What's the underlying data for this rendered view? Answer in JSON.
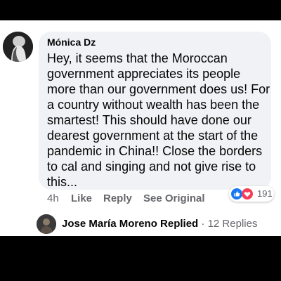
{
  "comment": {
    "author": "Mónica Dz",
    "text": "Hey, it seems that the Moroccan government appreciates its people more than our government does us! For a country without wealth has been the smartest! This should have done our dearest government at the start of the pandemic in China!! Close the borders to cal and singing and not give rise to this...",
    "time": "4h",
    "actions": {
      "like": "Like",
      "reply": "Reply",
      "see_original": "See Original"
    },
    "reactions": {
      "types": [
        "like-icon",
        "love-icon"
      ],
      "count": "191",
      "colors": {
        "like": "#1877f2",
        "love": "#f33e58"
      }
    }
  },
  "reply_summary": {
    "author": "Jose María Moreno",
    "action": "Replied",
    "separator": "·",
    "count": "12 Replies"
  }
}
